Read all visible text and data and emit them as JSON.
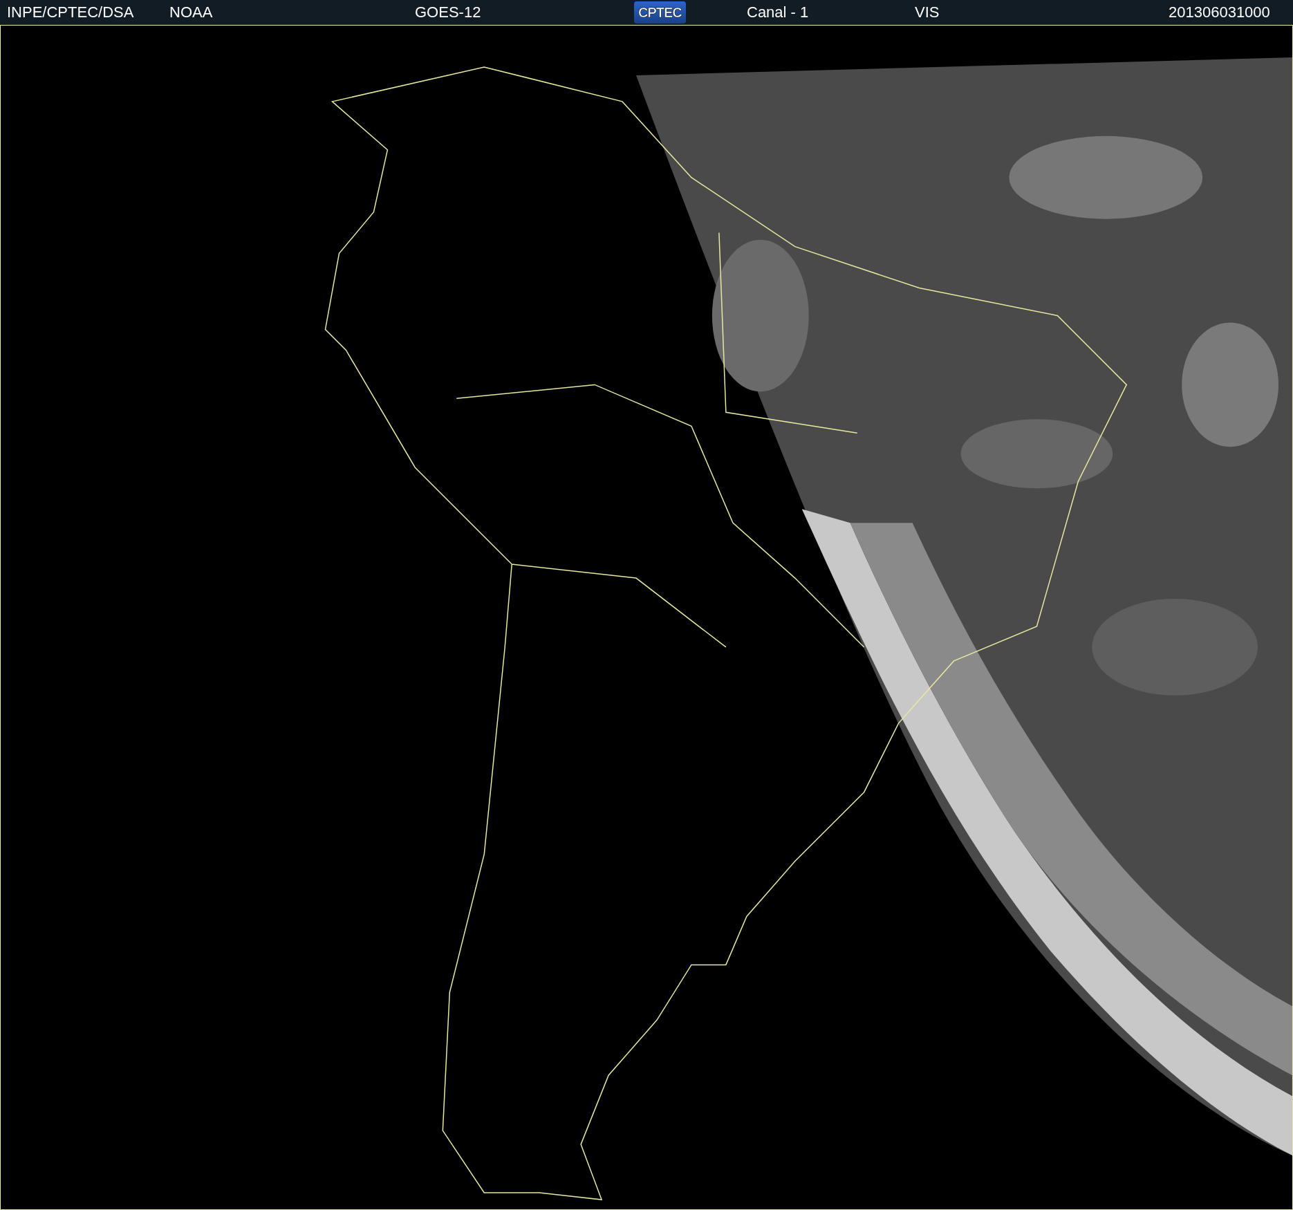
{
  "header": [
    {
      "kind": "text",
      "text": "INPE/CPTEC/DSA"
    },
    {
      "kind": "text",
      "text": "NOAA"
    },
    {
      "kind": "text",
      "text": "GOES-12"
    },
    {
      "kind": "logo",
      "text": "CPTEC"
    },
    {
      "kind": "text",
      "text": "Canal - 1"
    },
    {
      "kind": "text",
      "text": "VIS"
    },
    {
      "kind": "text",
      "text": "201306031000"
    }
  ]
}
